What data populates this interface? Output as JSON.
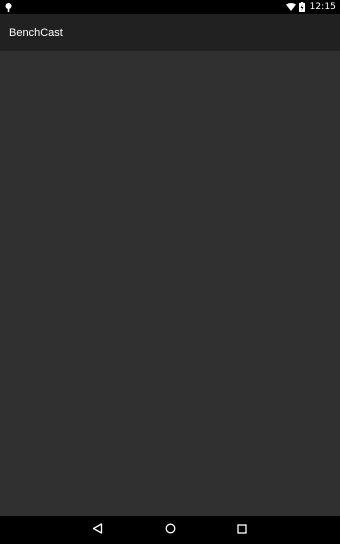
{
  "status_bar": {
    "time": "12:15",
    "icons": [
      "notification-pin-icon",
      "wifi-icon",
      "battery-charging-icon"
    ]
  },
  "app_bar": {
    "title": "BenchCast"
  },
  "nav_bar": {
    "buttons": [
      "back-icon",
      "home-icon",
      "recents-icon"
    ]
  },
  "colors": {
    "status_bar": "#000000",
    "app_bar": "#212121",
    "content_background": "#303030",
    "nav_bar": "#000000",
    "text": "#ffffff"
  }
}
